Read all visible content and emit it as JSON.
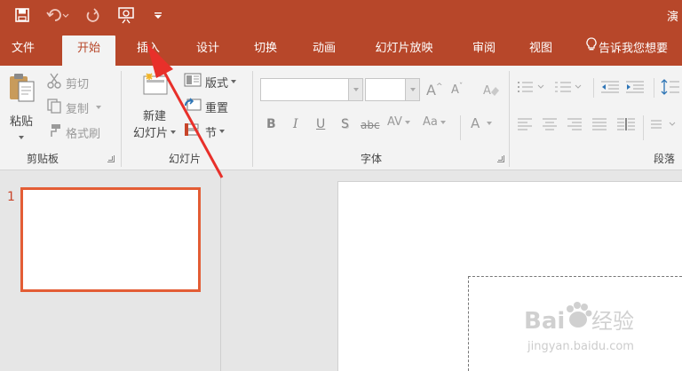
{
  "window": {
    "title_fragment": "演"
  },
  "tabs": [
    {
      "id": "file",
      "label": "文件"
    },
    {
      "id": "home",
      "label": "开始",
      "active": true
    },
    {
      "id": "insert",
      "label": "插入"
    },
    {
      "id": "design",
      "label": "设计"
    },
    {
      "id": "transitions",
      "label": "切换"
    },
    {
      "id": "animations",
      "label": "动画"
    },
    {
      "id": "slideshow",
      "label": "幻灯片放映"
    },
    {
      "id": "review",
      "label": "审阅"
    },
    {
      "id": "view",
      "label": "视图"
    },
    {
      "id": "tellme",
      "label": "告诉我您想要"
    }
  ],
  "clipboard": {
    "paste_label": "粘贴",
    "cut_label": "剪切",
    "copy_label": "复制",
    "format_painter_label": "格式刷",
    "group_label": "剪贴板"
  },
  "slides_group": {
    "new_slide_line1": "新建",
    "new_slide_line2": "幻灯片",
    "layout_label": "版式",
    "reset_label": "重置",
    "section_label": "节",
    "group_label": "幻灯片"
  },
  "font_group": {
    "font_name_value": "",
    "font_size_value": "",
    "grow_label": "A",
    "shrink_label": "A",
    "bold_label": "B",
    "italic_label": "I",
    "underline_label": "U",
    "shadow_label": "S",
    "strike_label": "abc",
    "spacing_label": "AV",
    "case_label": "Aa",
    "color_label": "A",
    "group_label": "字体"
  },
  "paragraph_group": {
    "group_label": "段落"
  },
  "thumbnails": [
    {
      "number": "1"
    }
  ],
  "watermark": {
    "brand": "Bai",
    "brand2": "经验",
    "url": "jingyan.baidu.com"
  },
  "colors": {
    "accent": "#b7472a",
    "annotation": "#e8302a",
    "thumb_border": "#e35d35"
  }
}
